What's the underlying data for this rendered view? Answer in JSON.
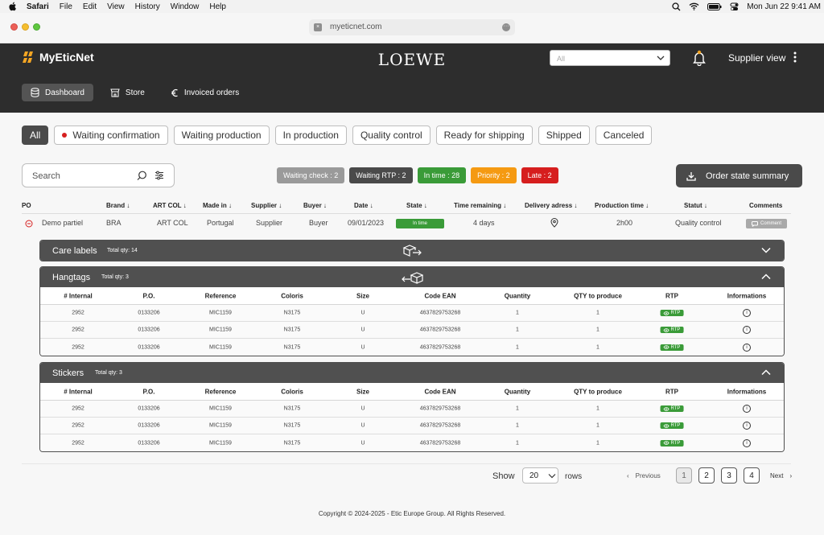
{
  "menubar": {
    "app": "Safari",
    "items": [
      "File",
      "Edit",
      "View",
      "History",
      "Window",
      "Help"
    ],
    "clock": "Mon Jun 22  9:41 AM"
  },
  "browser": {
    "url": "myeticnet.com"
  },
  "header": {
    "logo": "MyEticNet",
    "brand": "LOEWE",
    "select_placeholder": "All",
    "view": "Supplier view",
    "nav": [
      {
        "label": "Dashboard",
        "icon": "database-icon",
        "active": true
      },
      {
        "label": "Store",
        "icon": "store-icon",
        "active": false
      },
      {
        "label": "Invoiced orders",
        "icon": "euro-icon",
        "active": false
      }
    ]
  },
  "filters": [
    {
      "label": "All",
      "active": true
    },
    {
      "label": "Waiting confirmation",
      "dot": true
    },
    {
      "label": "Waiting production"
    },
    {
      "label": "In production"
    },
    {
      "label": "Quality control"
    },
    {
      "label": "Ready for shipping"
    },
    {
      "label": "Shipped"
    },
    {
      "label": "Canceled"
    }
  ],
  "search": {
    "placeholder": "Search"
  },
  "stats": [
    {
      "label": "Waiting check : 2",
      "color": "#9a9a9a"
    },
    {
      "label": "Waiting RTP : 2",
      "color": "#4a4a4a"
    },
    {
      "label": "In time : 28",
      "color": "#3a9b38"
    },
    {
      "label": "Priority : 2",
      "color": "#f59a12"
    },
    {
      "label": "Late : 2",
      "color": "#d61e1e"
    }
  ],
  "summary_button": "Order state summary",
  "table": {
    "columns": [
      "PO",
      "Brand",
      "ART COL",
      "Made in",
      "Supplier",
      "Buyer",
      "Date",
      "State",
      "Time remaining",
      "Delivery adress",
      "Production time",
      "Statut",
      "Comments"
    ],
    "row": {
      "po": "Demo partiel",
      "brand": "BRA",
      "artcol": "ART COL",
      "madein": "Portugal",
      "supplier": "Supplier",
      "buyer": "Buyer",
      "date": "09/01/2023",
      "state": "In time",
      "remaining": "4 days",
      "production": "2h00",
      "statut": "Quality control",
      "comment": "Comment"
    }
  },
  "sections": [
    {
      "title": "Care labels",
      "qty": "Total qty: 14",
      "expanded": false
    },
    {
      "title": "Hangtags",
      "qty": "Total qty: 3",
      "expanded": true
    },
    {
      "title": "Stickers",
      "qty": "Total qty: 3",
      "expanded": true
    }
  ],
  "subtable": {
    "columns": [
      "# Internal",
      "P.O.",
      "Reference",
      "Coloris",
      "Size",
      "Code EAN",
      "Quantity",
      "QTY to produce",
      "RTP",
      "Informations"
    ],
    "rows": [
      {
        "internal": "2952",
        "po": "0133206",
        "ref": "MIC1159",
        "coloris": "N3175",
        "size": "U",
        "ean": "4637829753268",
        "qty": "1",
        "toproduce": "1",
        "rtp": "RTP"
      },
      {
        "internal": "2952",
        "po": "0133206",
        "ref": "MIC1159",
        "coloris": "N3175",
        "size": "U",
        "ean": "4637829753268",
        "qty": "1",
        "toproduce": "1",
        "rtp": "RTP"
      },
      {
        "internal": "2952",
        "po": "0133206",
        "ref": "MIC1159",
        "coloris": "N3175",
        "size": "U",
        "ean": "4637829753268",
        "qty": "1",
        "toproduce": "1",
        "rtp": "RTP"
      }
    ]
  },
  "pagination": {
    "show": "Show",
    "rows_value": "20",
    "rows": "rows",
    "previous": "Previous",
    "next": "Next",
    "pages": [
      "1",
      "2",
      "3",
      "4"
    ],
    "current": "1"
  },
  "footer": "Copyright © 2024-2025 - Etic Europe Group. All Rights Reserved."
}
